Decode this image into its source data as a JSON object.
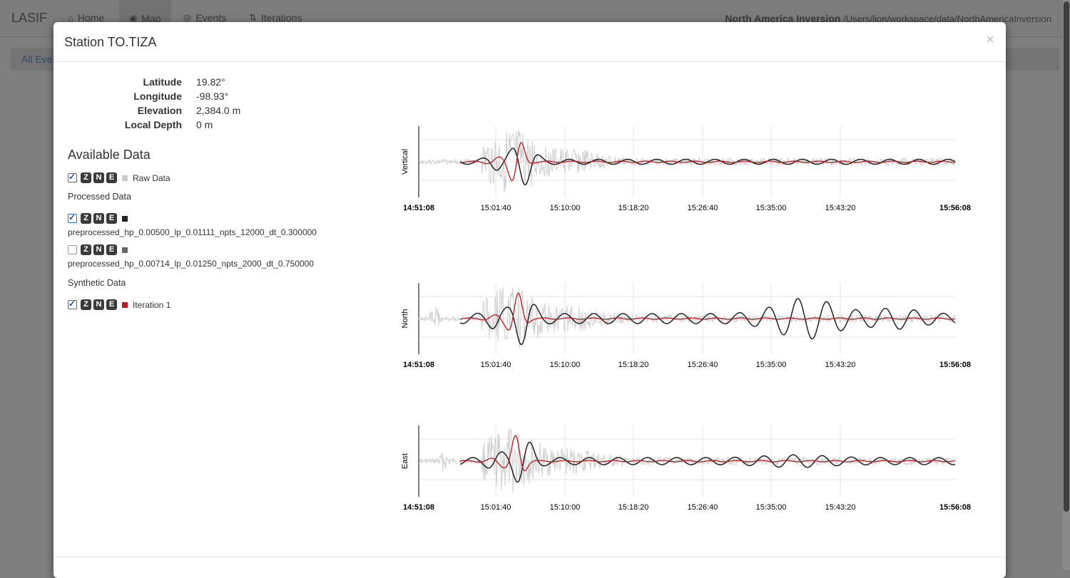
{
  "navbar": {
    "brand": "LASIF",
    "items": [
      {
        "label": "Home",
        "icon": "home-icon"
      },
      {
        "label": "Map",
        "icon": "globe-icon",
        "active": true
      },
      {
        "label": "Events",
        "icon": "target-icon"
      },
      {
        "label": "Iterations",
        "icon": "sort-icon"
      }
    ],
    "project_name": "North America Inversion",
    "project_path": "/Users/lion/workspace/data/NorthAmericaInversion"
  },
  "background": {
    "breadcrumb": "All Eve"
  },
  "modal": {
    "title": "Station TO.TIZA",
    "close": "×",
    "station": [
      {
        "key": "Latitude",
        "value": "19.82°"
      },
      {
        "key": "Longitude",
        "value": "-98.93°"
      },
      {
        "key": "Elevation",
        "value": "2,384.0 m"
      },
      {
        "key": "Local Depth",
        "value": "0 m"
      }
    ],
    "available_title": "Available Data",
    "raw": {
      "checked": true,
      "components": [
        "Z",
        "N",
        "E"
      ],
      "label": "Raw Data",
      "color": "#cccccc"
    },
    "processed_title": "Processed Data",
    "processed": [
      {
        "checked": true,
        "components": [
          "Z",
          "N",
          "E"
        ],
        "name": "preprocessed_hp_0.00500_lp_0.01111_npts_12000_dt_0.300000",
        "color": "#222222"
      },
      {
        "checked": false,
        "components": [
          "Z",
          "N",
          "E"
        ],
        "name": "preprocessed_hp_0.00714_lp_0.01250_npts_2000_dt_0.750000",
        "color": "#666666"
      }
    ],
    "synthetic_title": "Synthetic Data",
    "synthetic": [
      {
        "checked": true,
        "components": [
          "Z",
          "N",
          "E"
        ],
        "label": "Iteration 1",
        "color": "#c0161c"
      }
    ]
  },
  "chart_data": [
    {
      "type": "line",
      "ylabel": "Vertical",
      "x_start": "14:51:08",
      "x_end": "15:56:08",
      "xticks": [
        "15:01:40",
        "15:10:00",
        "15:18:20",
        "15:26:40",
        "15:35:00",
        "15:43:20"
      ]
    },
    {
      "type": "line",
      "ylabel": "North",
      "x_start": "14:51:08",
      "x_end": "15:56:08",
      "xticks": [
        "15:01:40",
        "15:10:00",
        "15:18:20",
        "15:26:40",
        "15:35:00",
        "15:43:20"
      ]
    },
    {
      "type": "line",
      "ylabel": "East",
      "x_start": "14:51:08",
      "x_end": "15:56:08",
      "xticks": [
        "15:01:40",
        "15:10:00",
        "15:18:20",
        "15:26:40",
        "15:35:00",
        "15:43:20"
      ]
    }
  ]
}
